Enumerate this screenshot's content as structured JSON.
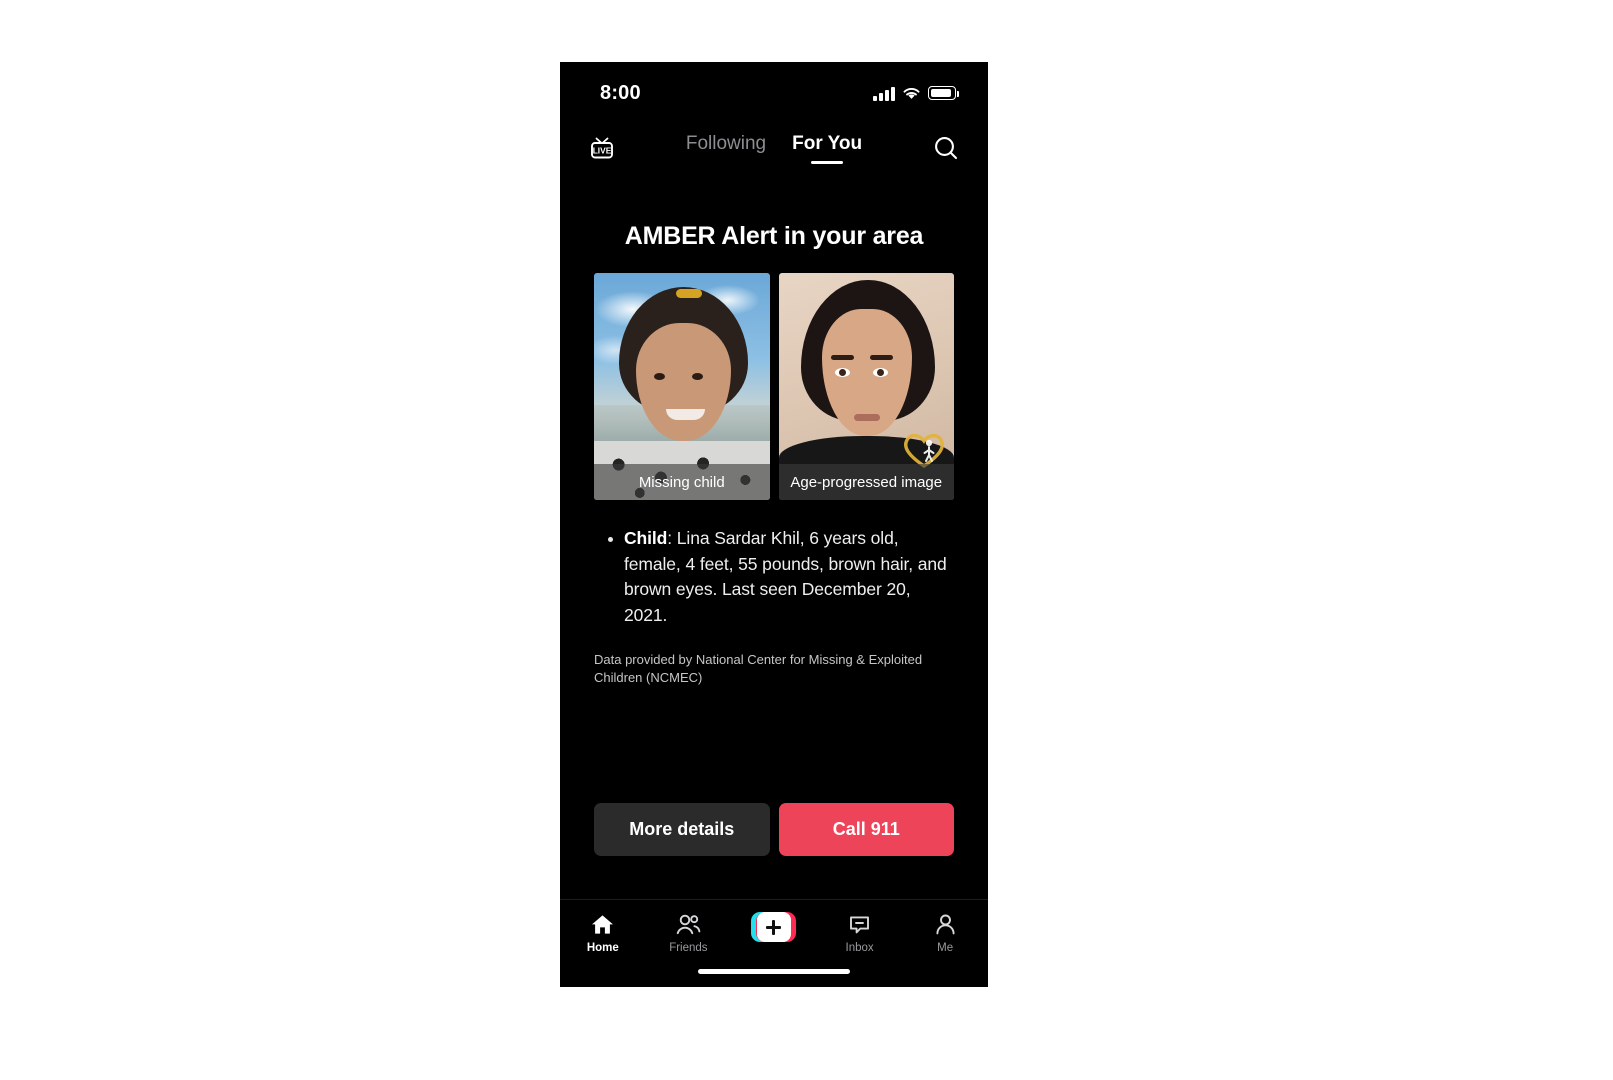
{
  "status_bar": {
    "time": "8:00",
    "signal_icon": "signal-bars-icon",
    "wifi_icon": "wifi-icon",
    "battery_icon": "battery-icon"
  },
  "top_nav": {
    "live_icon": "live-tv-icon",
    "search_icon": "search-icon",
    "tabs": [
      {
        "label": "Following",
        "active": false
      },
      {
        "label": "For You",
        "active": true
      }
    ]
  },
  "alert": {
    "title": "AMBER Alert in your area",
    "photos": [
      {
        "caption": "Missing child",
        "name": "missing-child-photo"
      },
      {
        "caption": "Age-progressed image",
        "name": "age-progressed-photo"
      }
    ],
    "details": [
      {
        "label": "Child",
        "separator": ": ",
        "text": "Lina Sardar Khil, 6 years old, female, 4 feet, 55 pounds, brown hair, and brown eyes. Last seen December 20, 2021."
      }
    ],
    "source_note": "Data provided by National Center for Missing & Exploited Children (NCMEC)",
    "watermark": "ncmec-logo-icon"
  },
  "actions": {
    "secondary_label": "More details",
    "primary_label": "Call 911"
  },
  "bottom_nav": {
    "items": [
      {
        "label": "Home",
        "icon": "home-icon",
        "active": true
      },
      {
        "label": "Friends",
        "icon": "friends-icon",
        "active": false
      },
      {
        "label": "",
        "icon": "create-plus-icon",
        "active": false
      },
      {
        "label": "Inbox",
        "icon": "inbox-icon",
        "active": false
      },
      {
        "label": "Me",
        "icon": "profile-icon",
        "active": false
      }
    ]
  },
  "colors": {
    "background": "#000000",
    "accent_red": "#ee4459",
    "secondary_button": "#2b2b2b",
    "tiktok_cyan": "#22e1ec",
    "tiktok_red": "#fe2c55",
    "muted_text": "#8d8d92"
  }
}
